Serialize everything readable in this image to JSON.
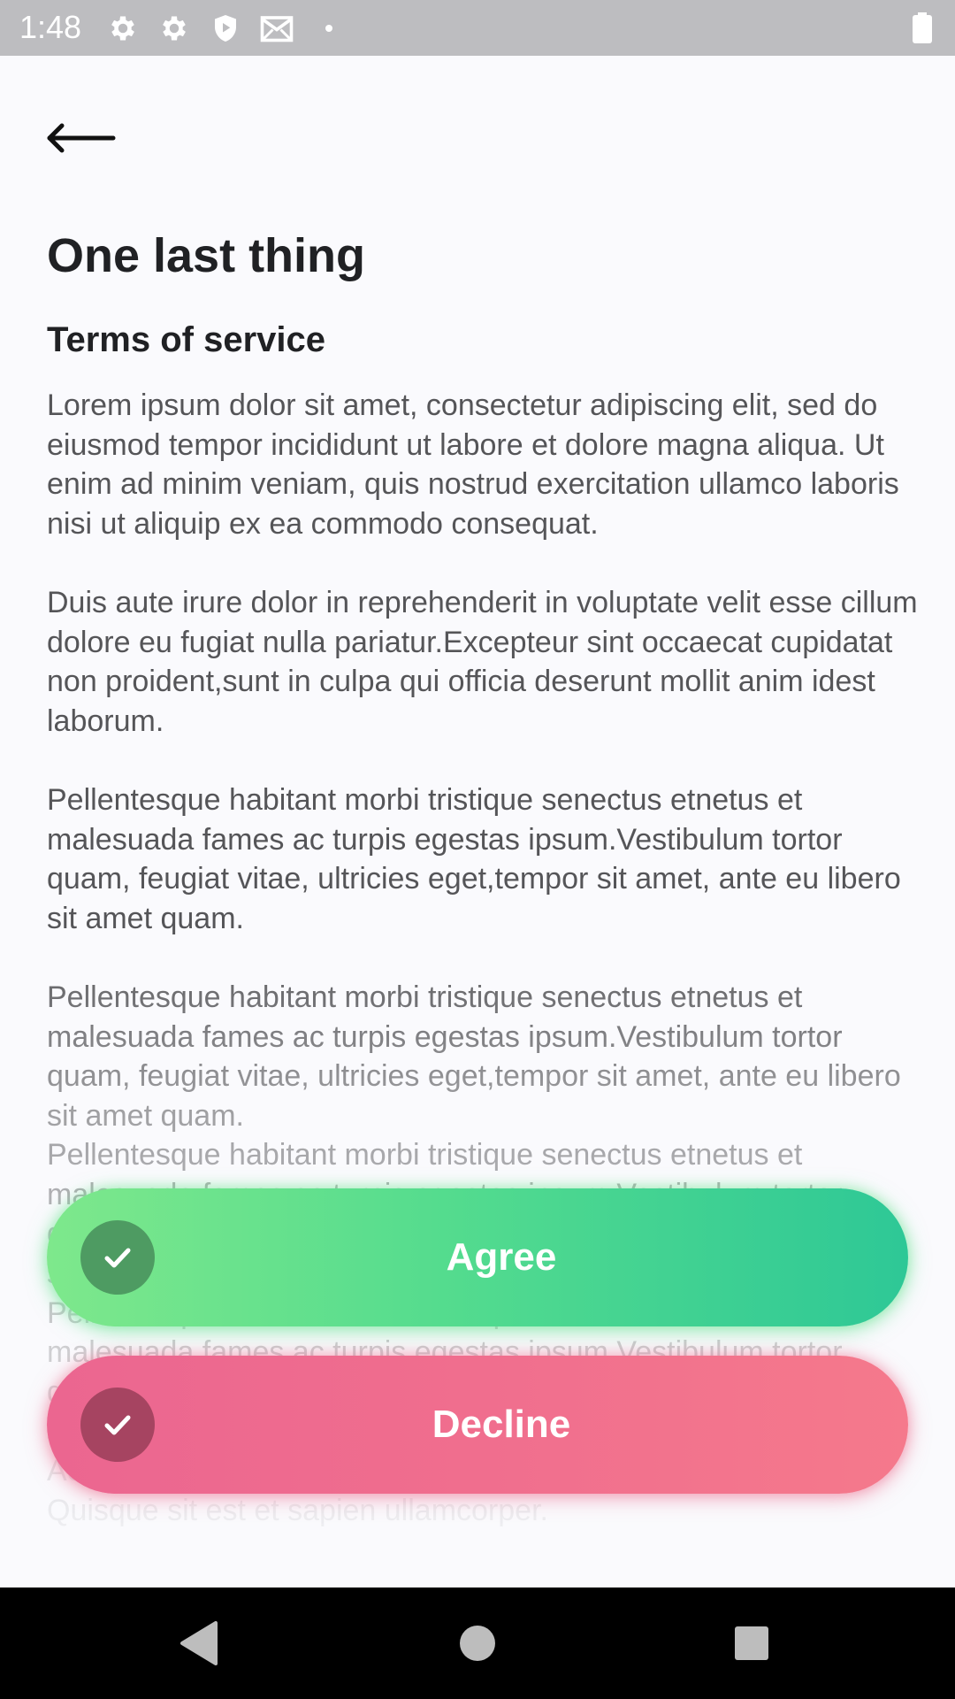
{
  "status_bar": {
    "time": "1:48",
    "icons": [
      "gear-icon",
      "gear-icon",
      "shield-icon",
      "mail-icon",
      "dot-icon",
      "battery-icon"
    ]
  },
  "header": {
    "back_icon": "arrow-left-icon"
  },
  "content": {
    "title": "One last thing",
    "section_title": "Terms of service",
    "paragraphs": [
      "Lorem ipsum dolor sit amet, consectetur adipiscing elit, sed do eiusmod tempor incididunt ut labore et dolore magna aliqua. Ut enim ad minim veniam, quis nostrud exercitation ullamco laboris nisi ut aliquip ex ea commodo consequat.",
      "Duis aute irure dolor in reprehenderit in voluptate velit esse cillum dolore eu fugiat nulla pariatur.Excepteur sint occaecat cupidatat non proident,sunt in culpa qui officia deserunt mollit anim idest laborum.",
      "Pellentesque habitant morbi tristique senectus etnetus et malesuada fames ac turpis egestas ipsum.Vestibulum tortor quam, feugiat vitae, ultricies eget,tempor sit amet, ante eu libero sit amet quam.",
      "Pellentesque habitant morbi tristique senectus etnetus et malesuada fames ac turpis egestas ipsum.Vestibulum tortor quam, feugiat vitae, ultricies eget,tempor sit amet, ante eu libero sit amet quam.",
      "Pellentesque habitant morbi tristique senectus etnetus et malesuada fames ac turpis egestas ipsum.Vestibulum tortor quam, feugiat vitae, ultricies eget,tempor sit amet, ante eu libero sit amet quam.",
      "Pellentesque habitant morbi tristique senectus etnetus et malesuada fames ac turpis egestas ipsum.Vestibulum tortor quam, feugiat vitae, ultricies eget,tempor sit amet, ante eu libero sit amet quam.",
      "Aenean ultricies mi vitae est. Mauris placerateleifend leo. Quisque sit est et sapien ullamcorper."
    ]
  },
  "actions": {
    "agree_label": "Agree",
    "decline_label": "Decline",
    "agree_icon": "check-icon",
    "decline_icon": "check-icon"
  },
  "nav_bar": {
    "back": "nav-back-icon",
    "home": "nav-home-icon",
    "recents": "nav-recents-icon"
  },
  "colors": {
    "status_bar": "#bdbdc0",
    "background": "#fafafd",
    "agree_gradient_start": "#7ee88c",
    "agree_gradient_end": "#2ec896",
    "decline_gradient_start": "#eb6690",
    "decline_gradient_end": "#f5798c",
    "title_text": "#202124",
    "body_text": "#555558"
  }
}
